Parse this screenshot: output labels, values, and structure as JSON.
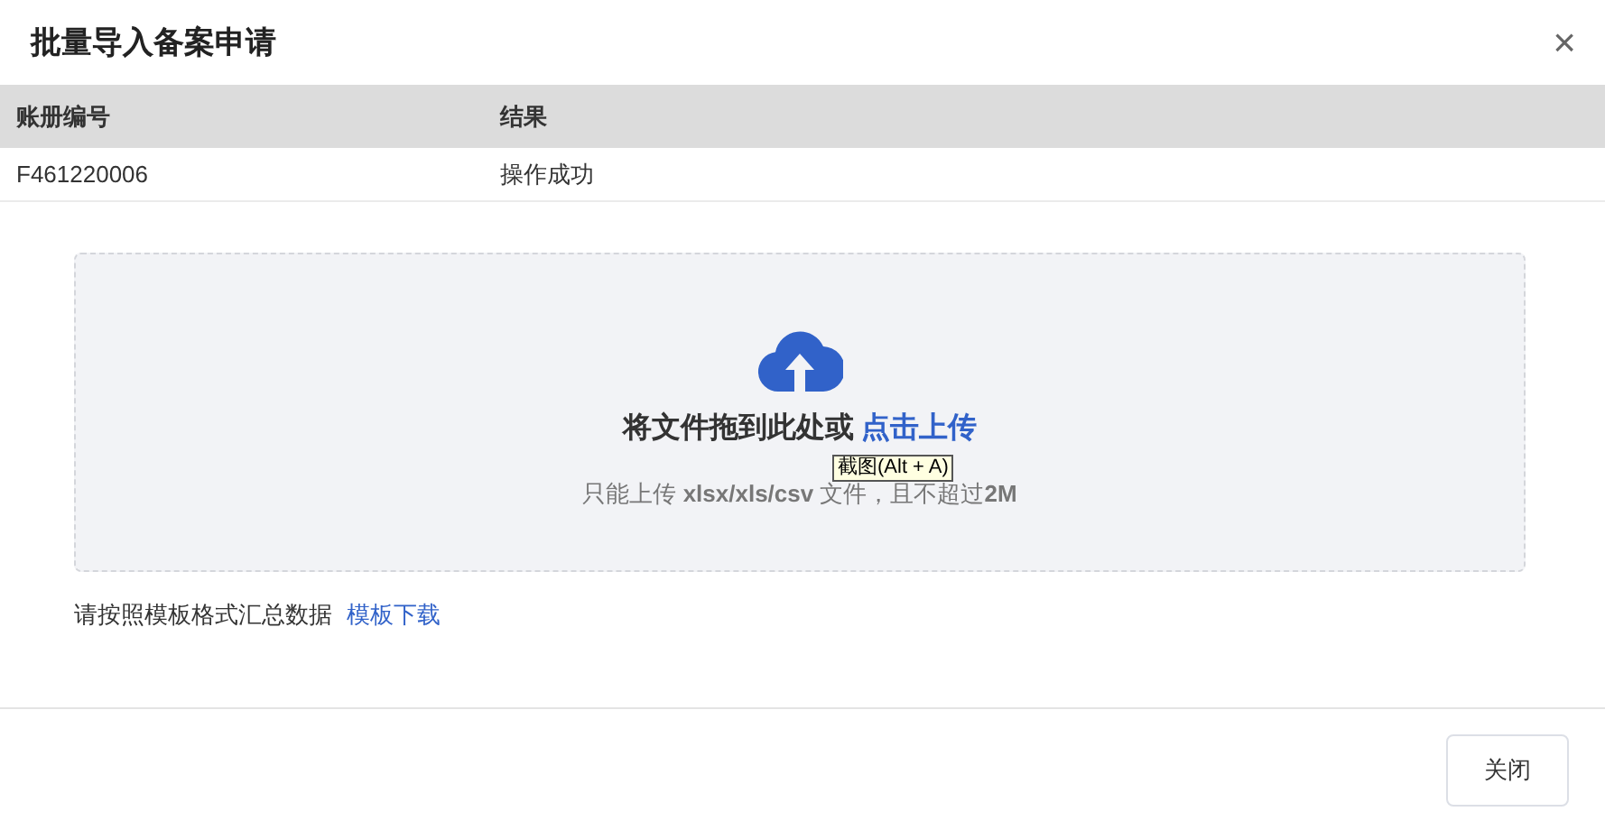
{
  "dialog": {
    "title": "批量导入备案申请",
    "close_icon": "×"
  },
  "table": {
    "columns": [
      "账册编号",
      "结果"
    ],
    "rows": [
      [
        "F461220006",
        "操作成功"
      ]
    ]
  },
  "upload": {
    "drop_text": "将文件拖到此处或",
    "drop_link": "点击上传",
    "hint": "只能上传 **xlsx/xls/csv** 文件，且不超过**2M**"
  },
  "template": {
    "text": "请按照模板格式汇总数据",
    "link": "模板下载"
  },
  "tooltip": "截图(Alt + A)",
  "buttons": [
    "关闭"
  ]
}
